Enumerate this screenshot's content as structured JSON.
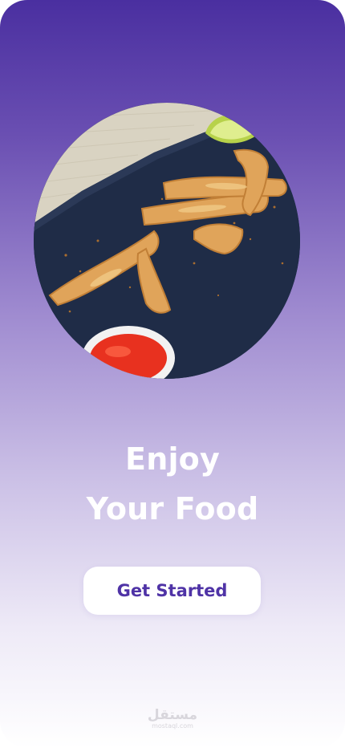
{
  "hero": {
    "image_subject": "fried-calamari-with-lime-and-chili-dip"
  },
  "headline": {
    "line1": "Enjoy",
    "line2": "Your Food"
  },
  "cta": {
    "label": "Get Started"
  },
  "watermark": {
    "arabic": "مستقل",
    "latin": "mostaql.com"
  },
  "colors": {
    "gradient_top": "#4a2fa0",
    "gradient_bottom": "#ffffff",
    "button_text": "#4f33a6"
  }
}
